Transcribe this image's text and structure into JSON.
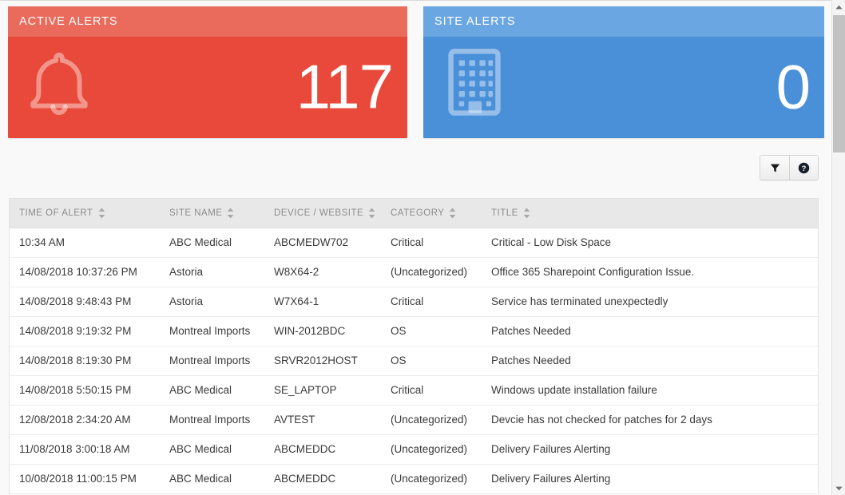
{
  "cards": [
    {
      "key": "active_alerts",
      "title": "ACTIVE ALERTS",
      "value": "117",
      "icon": "bell-icon",
      "color": "#e8493a",
      "header_color": "#ea6a5c"
    },
    {
      "key": "site_alerts",
      "title": "SITE ALERTS",
      "value": "0",
      "icon": "building-icon",
      "color": "#4a90d9",
      "header_color": "#6aa6e2"
    }
  ],
  "toolbar": {
    "filter_icon": "filter-funnel-icon",
    "help_icon": "help-question-icon"
  },
  "table": {
    "columns": [
      {
        "key": "time",
        "label": "TIME OF ALERT",
        "sortable": true
      },
      {
        "key": "site",
        "label": "SITE NAME",
        "sortable": true
      },
      {
        "key": "device",
        "label": "DEVICE / WEBSITE",
        "sortable": true
      },
      {
        "key": "category",
        "label": "CATEGORY",
        "sortable": true
      },
      {
        "key": "title",
        "label": "TITLE",
        "sortable": true
      }
    ],
    "rows": [
      {
        "time": "10:34 AM",
        "site": "ABC Medical",
        "device": "ABCMEDW702",
        "category": "Critical",
        "title": "Critical - Low Disk Space"
      },
      {
        "time": "14/08/2018 10:37:26 PM",
        "site": "Astoria",
        "device": "W8X64-2",
        "category": "(Uncategorized)",
        "title": "Office 365 Sharepoint Configuration Issue."
      },
      {
        "time": "14/08/2018 9:48:43 PM",
        "site": "Astoria",
        "device": "W7X64-1",
        "category": "Critical",
        "title": "Service has terminated unexpectedly"
      },
      {
        "time": "14/08/2018 9:19:32 PM",
        "site": "Montreal Imports",
        "device": "WIN-2012BDC",
        "category": "OS",
        "title": "Patches Needed"
      },
      {
        "time": "14/08/2018 8:19:30 PM",
        "site": "Montreal Imports",
        "device": "SRVR2012HOST",
        "category": "OS",
        "title": "Patches Needed"
      },
      {
        "time": "14/08/2018 5:50:15 PM",
        "site": "ABC Medical",
        "device": "SE_LAPTOP",
        "category": "Critical",
        "title": "Windows update installation failure"
      },
      {
        "time": "12/08/2018 2:34:20 AM",
        "site": "Montreal Imports",
        "device": "AVTEST",
        "category": "(Uncategorized)",
        "title": "Devcie has not checked for patches for 2 days"
      },
      {
        "time": "11/08/2018 3:00:18 AM",
        "site": "ABC Medical",
        "device": "ABCMEDDC",
        "category": "(Uncategorized)",
        "title": "Delivery Failures Alerting"
      },
      {
        "time": "10/08/2018 11:00:15 PM",
        "site": "ABC Medical",
        "device": "ABCMEDDC",
        "category": "(Uncategorized)",
        "title": "Delivery Failures Alerting"
      }
    ]
  },
  "scrollbar": {
    "up_icon": "scroll-up-arrow-icon",
    "down_icon": "scroll-down-arrow-icon"
  }
}
